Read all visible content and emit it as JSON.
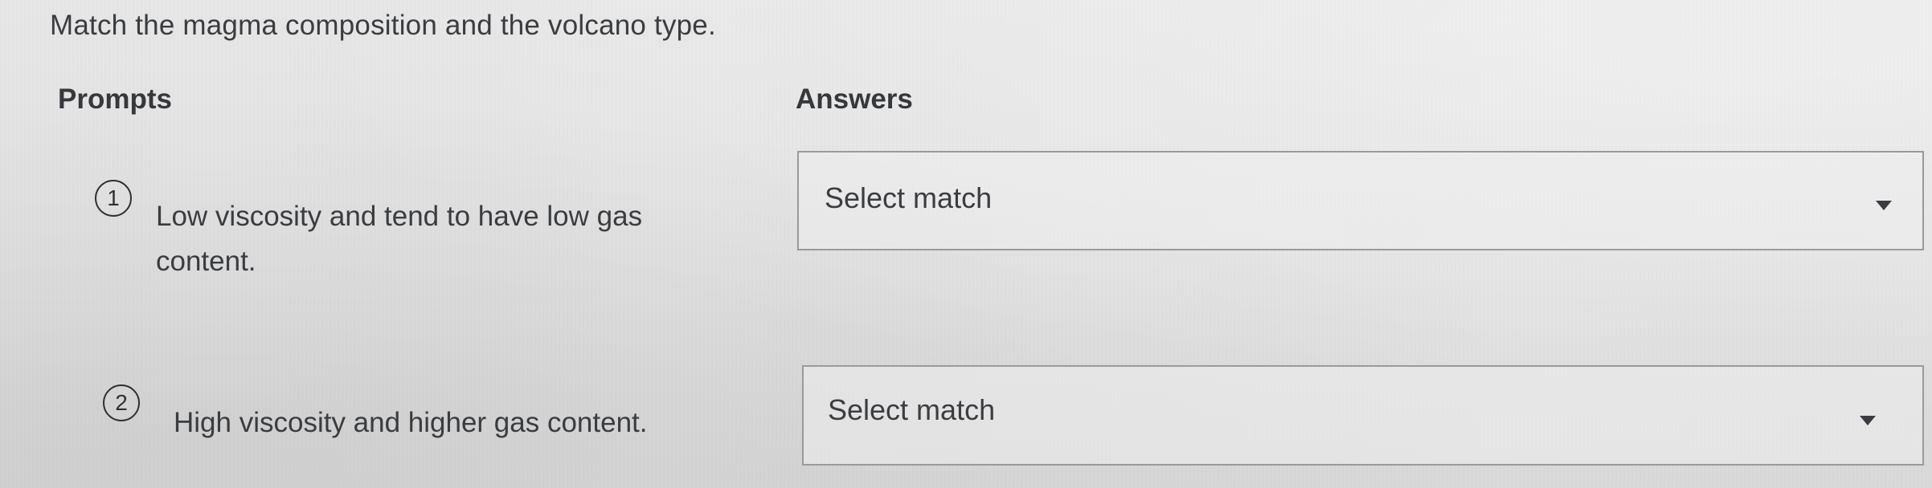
{
  "question": {
    "text": "Match the magma composition and the volcano type."
  },
  "headers": {
    "prompts": "Prompts",
    "answers": "Answers"
  },
  "prompts": [
    {
      "number": "1",
      "text": "Low viscosity and tend to have low gas content.",
      "answer_placeholder": "Select match"
    },
    {
      "number": "2",
      "text": "High viscosity and higher gas content.",
      "answer_placeholder": "Select match"
    }
  ],
  "icons": {
    "dropdown": "caret-down-icon"
  }
}
